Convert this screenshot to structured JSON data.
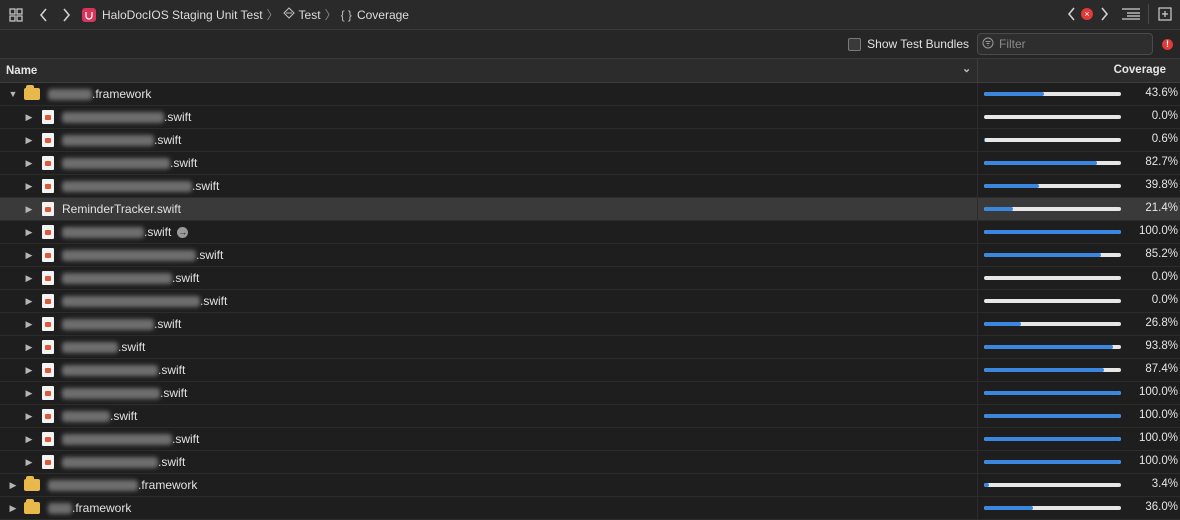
{
  "titlebar": {
    "crumbs": [
      {
        "label": "HaloDocIOS Staging Unit Test"
      },
      {
        "label": "Test"
      },
      {
        "label": "Coverage"
      }
    ]
  },
  "filterbar": {
    "show_test_bundles_label": "Show Test Bundles",
    "filter_placeholder": "Filter"
  },
  "table": {
    "col_name": "Name",
    "col_coverage": "Coverage",
    "rows": [
      {
        "kind": "framework",
        "expanded": true,
        "name": ".framework",
        "coverage": "43.6%",
        "ratio": 0.436
      },
      {
        "kind": "file",
        "name": ".swift",
        "coverage": "0.0%",
        "ratio": 0.0
      },
      {
        "kind": "file",
        "name": ".swift",
        "coverage": "0.6%",
        "ratio": 0.006
      },
      {
        "kind": "file",
        "name": ".swift",
        "coverage": "82.7%",
        "ratio": 0.827
      },
      {
        "kind": "file",
        "name": ".swift",
        "coverage": "39.8%",
        "ratio": 0.398
      },
      {
        "kind": "file",
        "name": "ReminderTracker.swift",
        "coverage": "21.4%",
        "ratio": 0.214,
        "selected": true
      },
      {
        "kind": "file",
        "name": ".swift",
        "coverage": "100.0%",
        "ratio": 1.0,
        "jump": true
      },
      {
        "kind": "file",
        "name": ".swift",
        "coverage": "85.2%",
        "ratio": 0.852
      },
      {
        "kind": "file",
        "name": ".swift",
        "coverage": "0.0%",
        "ratio": 0.0
      },
      {
        "kind": "file",
        "name": ".swift",
        "coverage": "0.0%",
        "ratio": 0.0
      },
      {
        "kind": "file",
        "name": ".swift",
        "coverage": "26.8%",
        "ratio": 0.268
      },
      {
        "kind": "file",
        "name": ".swift",
        "coverage": "93.8%",
        "ratio": 0.938
      },
      {
        "kind": "file",
        "name": ".swift",
        "coverage": "87.4%",
        "ratio": 0.874
      },
      {
        "kind": "file",
        "name": ".swift",
        "coverage": "100.0%",
        "ratio": 1.0
      },
      {
        "kind": "file",
        "name": ".swift",
        "coverage": "100.0%",
        "ratio": 1.0
      },
      {
        "kind": "file",
        "name": ".swift",
        "coverage": "100.0%",
        "ratio": 1.0
      },
      {
        "kind": "file",
        "name": ".swift",
        "coverage": "100.0%",
        "ratio": 1.0
      },
      {
        "kind": "framework",
        "expanded": false,
        "name": ".framework",
        "coverage": "3.4%",
        "ratio": 0.034
      },
      {
        "kind": "framework",
        "expanded": false,
        "name": ".framework",
        "coverage": "36.0%",
        "ratio": 0.36
      }
    ]
  },
  "colors": {
    "accent": "#3b86df",
    "error": "#e03a3a",
    "framework": "#e9b84a"
  }
}
